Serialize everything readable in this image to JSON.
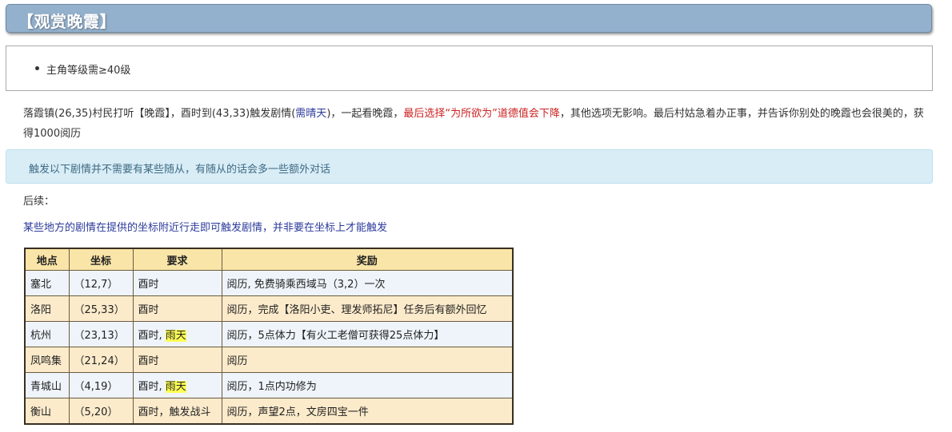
{
  "header": {
    "title": "【观赏晚霞】"
  },
  "requirements": {
    "items": [
      "主角等级需≥40级"
    ]
  },
  "description": {
    "part1": "落霞镇(26,35)村民打听【晚霞】，酉时到(43,33)触发剧情(",
    "weather": "需晴天",
    "part2": ")，一起看晚霞，",
    "warning": "最后选择“为所欲为”道德值会下降",
    "part3": "，其他选项无影响。最后村姑急着办正事，并告诉你别处的晚霞也会很美的，获得1000阅历"
  },
  "info": {
    "text": "触发以下剧情并不需要有某些随从，有随从的话会多一些额外对话"
  },
  "followup": {
    "label": "后续："
  },
  "note": {
    "text": "某些地方的剧情在提供的坐标附近行走即可触发剧情，并非要在坐标上才能触发"
  },
  "table": {
    "headers": [
      "地点",
      "坐标",
      "要求",
      "奖励"
    ],
    "rows": [
      {
        "place": "塞北",
        "coord": "（12,7）",
        "req": "酉时",
        "req_extra": "",
        "reward": "阅历, 免费骑乘西域马（3,2）一次"
      },
      {
        "place": "洛阳",
        "coord": "（25,33）",
        "req": "酉时",
        "req_extra": "",
        "reward": "阅历，完成【洛阳小吏、理发师拓尼】任务后有额外回忆"
      },
      {
        "place": "杭州",
        "coord": "（23,13）",
        "req": "酉时, ",
        "req_extra": "雨天",
        "reward": "阅历，5点体力【有火工老僧可获得25点体力】"
      },
      {
        "place": "凤鸣集",
        "coord": "（21,24）",
        "req": "酉时",
        "req_extra": "",
        "reward": "阅历"
      },
      {
        "place": "青城山",
        "coord": "（4,19）",
        "req": "酉时, ",
        "req_extra": "雨天",
        "reward": "阅历，1点内功修为"
      },
      {
        "place": "衡山",
        "coord": "（5,20）",
        "req": "酉时，触发战斗",
        "req_extra": "",
        "reward": "阅历，声望2点，文房四宝一件"
      }
    ]
  },
  "colors": {
    "title_bar": "#93b0cc",
    "info_bg": "#d9edf7",
    "table_header": "#fae5a8",
    "row_light": "#eef4fa",
    "row_warm": "#fcebcb",
    "warning_text": "#cc2222",
    "link_text": "#2b3a9a",
    "highlight": "#ffff55"
  }
}
